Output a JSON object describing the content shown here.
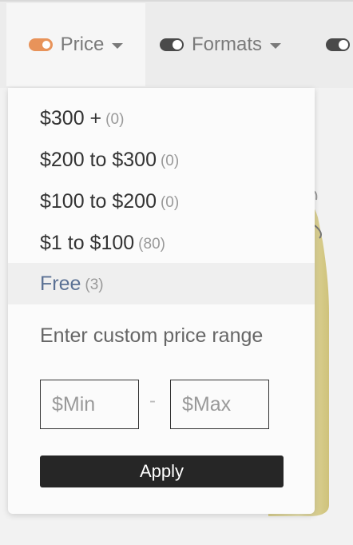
{
  "filters": {
    "price": {
      "label": "Price",
      "active": true
    },
    "formats": {
      "label": "Formats",
      "active": false
    }
  },
  "price_menu": {
    "options": [
      {
        "label": "$300 +",
        "count": "(0)"
      },
      {
        "label": "$200 to $300",
        "count": "(0)"
      },
      {
        "label": "$100 to $200",
        "count": "(0)"
      },
      {
        "label": "$1 to $100",
        "count": "(80)"
      },
      {
        "label": "Free",
        "count": "(3)",
        "selected": true
      }
    ],
    "custom_label": "Enter custom price range",
    "min_placeholder": "$Min",
    "max_placeholder": "$Max",
    "separator": "-",
    "apply_label": "Apply"
  },
  "colors": {
    "toggle_on": "#e8935a",
    "selected_text": "#5b7194",
    "apply_bg": "#262626"
  }
}
